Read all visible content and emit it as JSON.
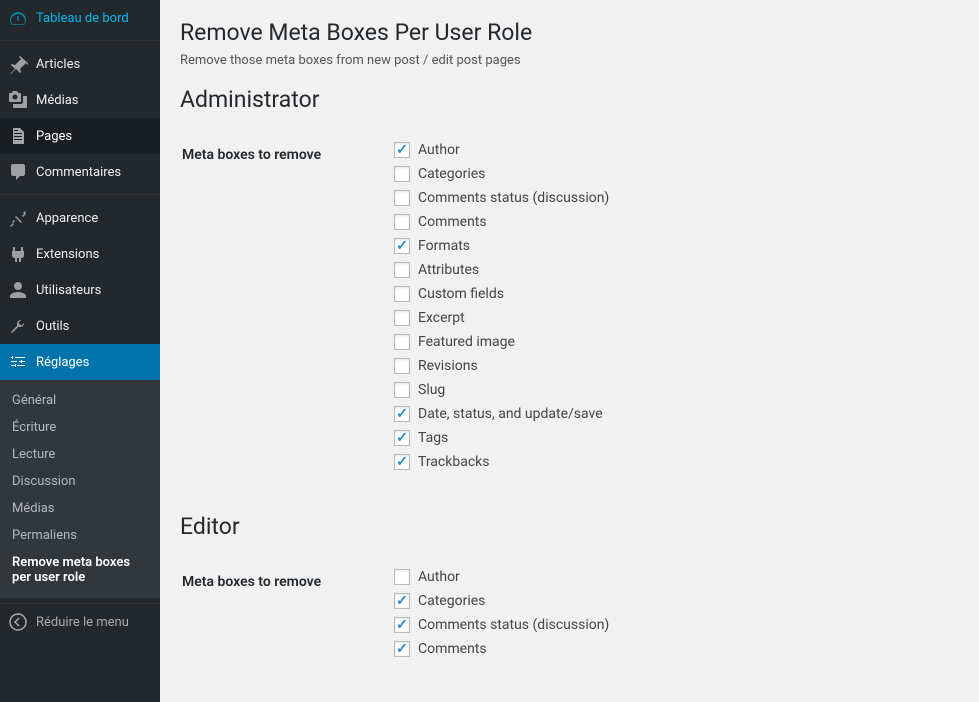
{
  "sidebar": {
    "items": [
      {
        "label": "Tableau de bord",
        "icon": "dashboard"
      },
      {
        "label": "Articles",
        "icon": "pin"
      },
      {
        "label": "Médias",
        "icon": "media"
      },
      {
        "label": "Pages",
        "icon": "pages",
        "open": true
      },
      {
        "label": "Commentaires",
        "icon": "comments"
      },
      {
        "label": "Apparence",
        "icon": "appearance"
      },
      {
        "label": "Extensions",
        "icon": "plugins"
      },
      {
        "label": "Utilisateurs",
        "icon": "users"
      },
      {
        "label": "Outils",
        "icon": "tools"
      },
      {
        "label": "Réglages",
        "icon": "settings",
        "current": true
      }
    ],
    "submenu": [
      {
        "label": "Général"
      },
      {
        "label": "Écriture"
      },
      {
        "label": "Lecture"
      },
      {
        "label": "Discussion"
      },
      {
        "label": "Médias"
      },
      {
        "label": "Permaliens"
      },
      {
        "label": "Remove meta boxes per user role",
        "current": true
      }
    ],
    "collapse": "Réduire le menu"
  },
  "page": {
    "title": "Remove Meta Boxes Per User Role",
    "description": "Remove those meta boxes from new post / edit post pages",
    "sections": [
      {
        "heading": "Administrator",
        "field_label": "Meta boxes to remove",
        "options": [
          {
            "label": "Author",
            "checked": true
          },
          {
            "label": "Categories",
            "checked": false
          },
          {
            "label": "Comments status (discussion)",
            "checked": false
          },
          {
            "label": "Comments",
            "checked": false
          },
          {
            "label": "Formats",
            "checked": true
          },
          {
            "label": "Attributes",
            "checked": false
          },
          {
            "label": "Custom fields",
            "checked": false
          },
          {
            "label": "Excerpt",
            "checked": false
          },
          {
            "label": "Featured image",
            "checked": false
          },
          {
            "label": "Revisions",
            "checked": false
          },
          {
            "label": "Slug",
            "checked": false
          },
          {
            "label": "Date, status, and update/save",
            "checked": true
          },
          {
            "label": "Tags",
            "checked": true
          },
          {
            "label": "Trackbacks",
            "checked": true
          }
        ]
      },
      {
        "heading": "Editor",
        "field_label": "Meta boxes to remove",
        "options": [
          {
            "label": "Author",
            "checked": false
          },
          {
            "label": "Categories",
            "checked": true
          },
          {
            "label": "Comments status (discussion)",
            "checked": true
          },
          {
            "label": "Comments",
            "checked": true
          }
        ]
      }
    ]
  }
}
